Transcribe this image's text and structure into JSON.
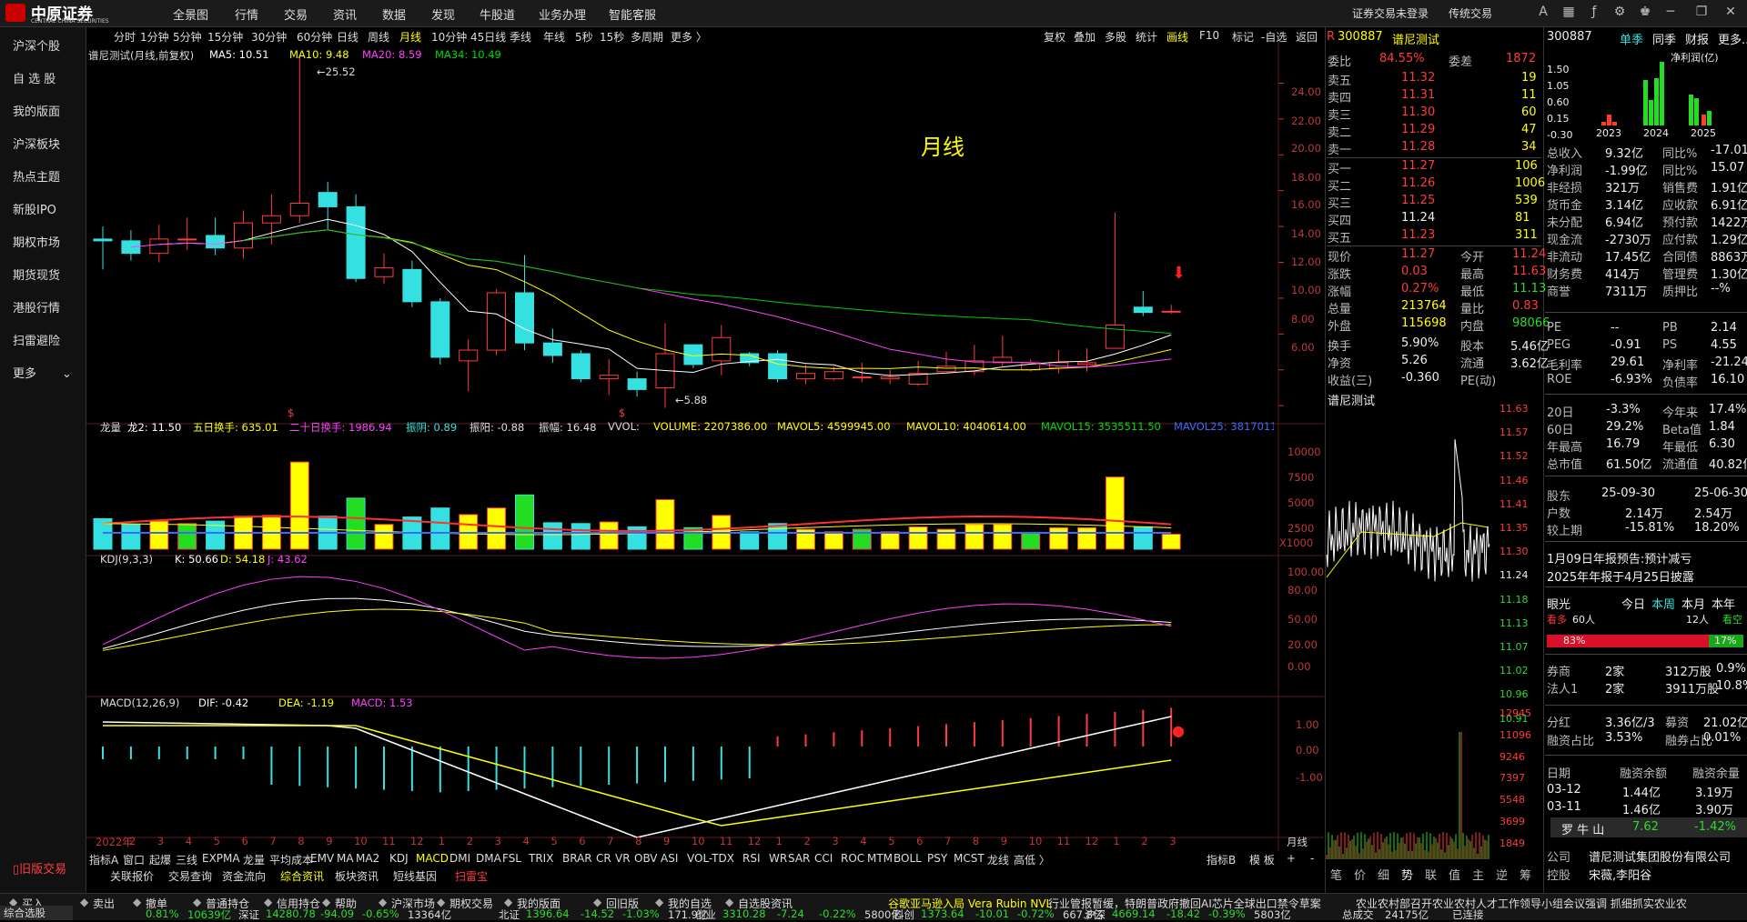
{
  "app": {
    "logo": "中原证券",
    "logo_sub": "CENTRAL CHINA SECURITIES"
  },
  "top_menu": [
    "全景图",
    "行情",
    "交易",
    "资讯",
    "数据",
    "发现",
    "牛股道",
    "业务办理",
    "智能客服"
  ],
  "top_right": [
    "证券交易未登录",
    "传统交易"
  ],
  "top_icons": [
    "font-size-icon",
    "grid-icon",
    "formula-icon",
    "gear-icon",
    "shirt-icon",
    "minimize-icon",
    "restore-icon",
    "close-icon"
  ],
  "left_nav": [
    "沪深个股",
    "自 选 股",
    "我的版面",
    "沪深板块",
    "热点主题",
    "新股IPO",
    "期权市场",
    "期货现货",
    "港股行情",
    "扫雷避险",
    "更多"
  ],
  "left_nav_bottom": "旧版交易",
  "period_tabs": [
    "分时",
    "1分钟",
    "5分钟",
    "15分钟",
    "30分钟",
    "60分钟",
    "日线",
    "周线",
    "月线",
    "10分钟",
    "45日线",
    "季线",
    "年线",
    "5秒",
    "15秒",
    "多周期",
    "更多 〉"
  ],
  "active_period": "月线",
  "right_tools": [
    "复权",
    "叠加",
    "多股",
    "统计",
    "画线",
    "F10",
    "标记",
    "-自选",
    "返回"
  ],
  "main_legend": {
    "title": "谱尼测试(月线,前复权)",
    "ma5": "MA5: 10.51",
    "ma10": "MA10: 9.48",
    "ma20": "MA20: 8.59",
    "ma34": "MA34: 10.49"
  },
  "watermark": "月线",
  "annotations": {
    "high": "25.52",
    "low": "←5.88",
    "dollar": "$"
  },
  "price_axis": [
    "24.00",
    "22.00",
    "20.00",
    "18.00",
    "16.00",
    "14.00",
    "12.00",
    "10.00",
    "8.00",
    "6.00"
  ],
  "vol_legend": {
    "a": "龙量",
    "b": "龙2: 11.50",
    "c": "五日换手: 635.01",
    "d": "二十日换手: 1986.94",
    "e": "振阴: 0.89",
    "f": "振阳: -0.88",
    "g": "振幅: 16.48",
    "h": "VVOL:",
    "i": "VOLUME: 2207386.00",
    "j": "MAVOL5: 4599945.00",
    "k": "MAVOL10: 4040614.00",
    "l": "MAVOL15: 3535511.50",
    "m": "MAVOL25: 3817011"
  },
  "vol_axis": [
    "10000",
    "7500",
    "5000",
    "2500"
  ],
  "vol_unit": "X1000",
  "kdj_legend": {
    "a": "KDJ(9,3,3)",
    "k": "K: 50.66",
    "d": "D: 54.18",
    "j": "J: 43.62"
  },
  "kdj_axis": [
    "100.00",
    "80.00",
    "50.00",
    "20.00",
    "0.00"
  ],
  "macd_legend": {
    "a": "MACD(12,26,9)",
    "dif": "DIF: -0.42",
    "dea": "DEA: -1.19",
    "macd": "MACD: 1.53"
  },
  "macd_axis": [
    "1.00",
    "0.00",
    "-1.00"
  ],
  "x_axis": [
    "2022年",
    "2",
    "3",
    "4",
    "5",
    "6",
    "7",
    "8",
    "9",
    "10",
    "11",
    "12",
    "1",
    "2",
    "3",
    "4",
    "5",
    "6",
    "7",
    "8",
    "9",
    "10",
    "11",
    "12",
    "1",
    "2",
    "3",
    "4",
    "5",
    "6",
    "7",
    "8",
    "9",
    "10",
    "11",
    "12",
    "1",
    "2",
    "3"
  ],
  "x_axis_unit": "月线",
  "bottom_tabs": [
    "指标A",
    "窗口",
    "起爆",
    "三线",
    "EXPMA",
    "龙量",
    "平均成本",
    "EMV",
    "MA",
    "MA2",
    "KDJ",
    "MACD",
    "DMI",
    "DMA",
    "FSL",
    "TRIX",
    "BRAR",
    "CR",
    "VR",
    "OBV",
    "ASI",
    "VOL-TDX",
    "RSI",
    "WR",
    "SAR",
    "CCI",
    "ROC",
    "MTM",
    "BOLL",
    "PSY",
    "MCST",
    "龙线",
    "高低 〉"
  ],
  "bottom_tabs_right": [
    "指标B",
    "模 板",
    "+",
    "-"
  ],
  "sub_tabs": [
    "关联报价",
    "交易查询",
    "资金流向",
    "综合资讯",
    "板块资讯",
    "短线基因",
    "扫雷宝"
  ],
  "quote": {
    "code": "300887",
    "name": "谱尼测试",
    "webi_label": "委比",
    "webi": "84.55%",
    "weicha_label": "委差",
    "weicha": "1872",
    "asks": [
      {
        "l": "卖五",
        "p": "11.32",
        "v": "19"
      },
      {
        "l": "卖四",
        "p": "11.31",
        "v": "11"
      },
      {
        "l": "卖三",
        "p": "11.30",
        "v": "60"
      },
      {
        "l": "卖二",
        "p": "11.29",
        "v": "47"
      },
      {
        "l": "卖一",
        "p": "11.28",
        "v": "34"
      }
    ],
    "bids": [
      {
        "l": "买一",
        "p": "11.27",
        "v": "106"
      },
      {
        "l": "买二",
        "p": "11.26",
        "v": "1006"
      },
      {
        "l": "买三",
        "p": "11.25",
        "v": "539"
      },
      {
        "l": "买四",
        "p": "11.24",
        "v": "81"
      },
      {
        "l": "买五",
        "p": "11.23",
        "v": "311"
      }
    ],
    "stats": [
      [
        "现价",
        "11.27",
        "今开",
        "11.24"
      ],
      [
        "涨跌",
        "0.03",
        "最高",
        "11.63"
      ],
      [
        "涨幅",
        "0.27%",
        "最低",
        "11.13"
      ],
      [
        "总量",
        "213764",
        "量比",
        "0.83"
      ],
      [
        "外盘",
        "115698",
        "内盘",
        "98066"
      ]
    ],
    "stats2": [
      [
        "换手",
        "5.90%",
        "股本",
        "5.46亿"
      ],
      [
        "净资",
        "5.26",
        "流通",
        "3.62亿"
      ],
      [
        "收益(三)",
        "-0.360",
        "PE(动)",
        ""
      ]
    ],
    "mini_name": "谱尼测试",
    "mini_axis": [
      "11.63",
      "11.57",
      "11.52",
      "11.46",
      "11.41",
      "11.35",
      "11.30",
      "11.24",
      "11.18",
      "11.13",
      "11.07",
      "11.02",
      "10.96",
      "10.91",
      "12945",
      "11096",
      "9246",
      "7397",
      "5548",
      "3699",
      "1849"
    ]
  },
  "fin": {
    "code": "300887",
    "tabs": [
      "单季",
      "同季",
      "财报",
      "更多.."
    ],
    "chart_label": "净利润(亿)",
    "chart_axis": [
      "1.50",
      "1.05",
      "0.60",
      "0.15",
      "-0.30"
    ],
    "years": [
      "2023",
      "2024",
      "2025"
    ],
    "rows": [
      [
        "总收入",
        "9.32亿",
        "同比%",
        "-17.01"
      ],
      [
        "净利润",
        "-1.99亿",
        "同比%",
        "15.07"
      ],
      [
        "非经损",
        "321万",
        "销售费",
        "1.91亿"
      ],
      [
        "货币金",
        "3.14亿",
        "应收款",
        "6.91亿"
      ],
      [
        "未分配",
        "6.94亿",
        "预付款",
        "1422万"
      ],
      [
        "现金流",
        "-2730万",
        "应付款",
        "1.29亿"
      ],
      [
        "非流动",
        "17.45亿",
        "合同债",
        "8863万"
      ],
      [
        "财务费",
        "414万",
        "管理费",
        "1.30亿"
      ],
      [
        "商誉",
        "7311万",
        "质押比",
        "--%"
      ]
    ],
    "val": [
      [
        "PE",
        "--",
        "PB",
        "2.14"
      ],
      [
        "PEG",
        "-0.91",
        "PS",
        "4.55"
      ],
      [
        "毛利率",
        "29.61",
        "净利率",
        "-21.24"
      ],
      [
        "ROE",
        "-6.93%",
        "负债率",
        "16.10"
      ]
    ],
    "perf": [
      [
        "20日",
        "-3.3%",
        "今年来",
        "17.4%"
      ],
      [
        "60日",
        "29.2%",
        "Beta值",
        "1.84"
      ],
      [
        "年最高",
        "16.79",
        "年最低",
        "6.30"
      ],
      [
        "总市值",
        "61.50亿",
        "流通值",
        "40.82亿"
      ]
    ],
    "holders": [
      [
        "股东",
        "25-09-30",
        "",
        "25-06-30"
      ],
      [
        "户数",
        "",
        "2.14万",
        "2.54万"
      ],
      [
        "较上期",
        "",
        "-15.81%",
        "18.20%"
      ]
    ],
    "notice1": "1月09日年报预告:预计减亏",
    "notice2": "2025年年报于4月25日披露",
    "eye": "眼光",
    "eye_tabs": [
      "今日",
      "本周",
      "本月",
      "本年"
    ],
    "bull": "看多",
    "bull_n": "60人",
    "bear_n": "12人",
    "bear": "看空",
    "bull_pct": "83%",
    "bear_pct": "17%",
    "inst": [
      [
        "券商",
        "2家",
        "312万股",
        "0.9%"
      ],
      [
        "法人1",
        "2家",
        "3911万股",
        "10.8%"
      ]
    ],
    "div": [
      [
        "分红",
        "3.36亿/3",
        "募资",
        "21.02亿/5"
      ],
      [
        "融资占比",
        "3.53%",
        "融券占比",
        "0.01%"
      ]
    ],
    "margin_head": [
      "日期",
      "融资余额",
      "融资余量"
    ],
    "margin": [
      [
        "03-12",
        "1.44亿",
        "3.19万"
      ],
      [
        "03-11",
        "1.46亿",
        "3.90万"
      ]
    ],
    "ticker": {
      "name": "罗 牛 山",
      "price": "7.62",
      "chg": "-1.42%"
    },
    "company": "谱尼测试集团股份有限公司",
    "controller": "宋薇,李阳谷",
    "company_label": "公司",
    "controller_label": "控股"
  },
  "right_bottom_tabs": [
    "笔",
    "价",
    "细",
    "势",
    "联",
    "值",
    "主",
    "逆",
    "筹"
  ],
  "toolbar": [
    "买入",
    "卖出",
    "撤单",
    "普通持仓",
    "信用持仓",
    "帮助",
    "沪深市场",
    "期权交易",
    "我的版面",
    "回旧版",
    "我的自选",
    "自选股资讯"
  ],
  "news": [
    "谷歌亚马逊入局 Vera Rubin NVL",
    "行业管报暂缓，特朗普政府撤回AI芯片全球出口禁令草案",
    "农业农村部召开农业农村人才工作领导小组会议强调 抓细抓实农业农"
  ],
  "status_bar": {
    "left": "综合选股",
    "left2": "0.81%",
    "items": [
      [
        "10639亿",
        ""
      ],
      [
        "深证",
        "14280.78",
        "-94.09",
        "-0.65%",
        "13364亿"
      ],
      [
        "北证",
        "1396.64",
        "-14.52",
        "-1.03%",
        "171.9亿"
      ],
      [
        "创业",
        "3310.28",
        "-7.24",
        "-0.22%",
        "5800亿"
      ],
      [
        "科创",
        "1373.64",
        "-10.01",
        "-0.72%",
        "667.8亿"
      ],
      [
        "沪深",
        "4669.14",
        "-18.42",
        "-0.39%",
        "5803亿"
      ]
    ],
    "total_label": "总成交",
    "total": "24175亿",
    "conn": "已连接"
  },
  "colors": {
    "up": "#ff3b3b",
    "down": "#35e0e0",
    "ma5": "#ffffff",
    "ma10": "#ffff00",
    "ma20": "#ff40ff",
    "ma34": "#00cc00"
  },
  "chart_data": {
    "type": "candlestick",
    "title": "谱尼测试(月线,前复权)",
    "period": "monthly",
    "ylim": [
      5.5,
      25.8
    ],
    "candles": [
      [
        15.3,
        15.2,
        16.0,
        13.6
      ],
      [
        15.2,
        14.5,
        15.8,
        14.1
      ],
      [
        14.5,
        15.3,
        16.1,
        14.0
      ],
      [
        15.3,
        15.3,
        16.5,
        14.7
      ],
      [
        15.5,
        14.8,
        16.5,
        14.4
      ],
      [
        14.8,
        16.2,
        16.9,
        14.2
      ],
      [
        16.2,
        16.6,
        17.8,
        15.0
      ],
      [
        16.6,
        17.3,
        25.52,
        16.2
      ],
      [
        17.9,
        17.1,
        18.5,
        15.8
      ],
      [
        17.1,
        13.1,
        17.8,
        12.9
      ],
      [
        13.2,
        13.7,
        14.5,
        12.8
      ],
      [
        13.6,
        11.8,
        14.1,
        11.5
      ],
      [
        11.8,
        8.7,
        12.0,
        8.3
      ],
      [
        8.5,
        9.1,
        9.7,
        6.8
      ],
      [
        9.1,
        12.3,
        12.5,
        8.8
      ],
      [
        12.3,
        9.5,
        14.4,
        9.1
      ],
      [
        9.5,
        8.8,
        10.3,
        8.4
      ],
      [
        8.9,
        7.5,
        9.1,
        7.3
      ],
      [
        7.5,
        7.7,
        8.6,
        6.6
      ],
      [
        7.5,
        6.9,
        7.9,
        6.5
      ],
      [
        7.0,
        8.9,
        10.6,
        5.88
      ],
      [
        9.4,
        8.3,
        9.4,
        8.1
      ],
      [
        8.5,
        9.8,
        10.5,
        7.7
      ],
      [
        8.9,
        8.4,
        9.0,
        8.2
      ],
      [
        8.9,
        7.5,
        9.1,
        7.3
      ],
      [
        7.5,
        7.8,
        8.3,
        7.2
      ],
      [
        7.5,
        7.9,
        8.2,
        7.4
      ],
      [
        7.6,
        7.6,
        8.4,
        7.3
      ],
      [
        7.5,
        7.6,
        8.0,
        7.2
      ],
      [
        7.2,
        7.8,
        8.5,
        7.1
      ],
      [
        7.9,
        8.2,
        9.0,
        7.9
      ],
      [
        7.9,
        8.5,
        9.4,
        7.7
      ],
      [
        8.4,
        8.7,
        9.9,
        8.2
      ],
      [
        8.0,
        8.4,
        8.6,
        7.9
      ],
      [
        8.1,
        8.4,
        9.1,
        7.8
      ],
      [
        8.3,
        8.4,
        9.2,
        7.9
      ],
      [
        9.2,
        10.5,
        16.79,
        9.3
      ],
      [
        11.5,
        11.2,
        12.4,
        11.0
      ],
      [
        11.24,
        11.27,
        11.63,
        11.13
      ]
    ],
    "volume_k": [
      0,
      0,
      0,
      0,
      0,
      0,
      0,
      0,
      0,
      0,
      0,
      0,
      2400,
      0,
      0,
      0,
      0,
      0,
      0,
      0,
      0,
      0,
      0,
      0,
      2400,
      0,
      0,
      0,
      0,
      0,
      0,
      0,
      0,
      0,
      0,
      0,
      0,
      0,
      2207
    ]
  }
}
